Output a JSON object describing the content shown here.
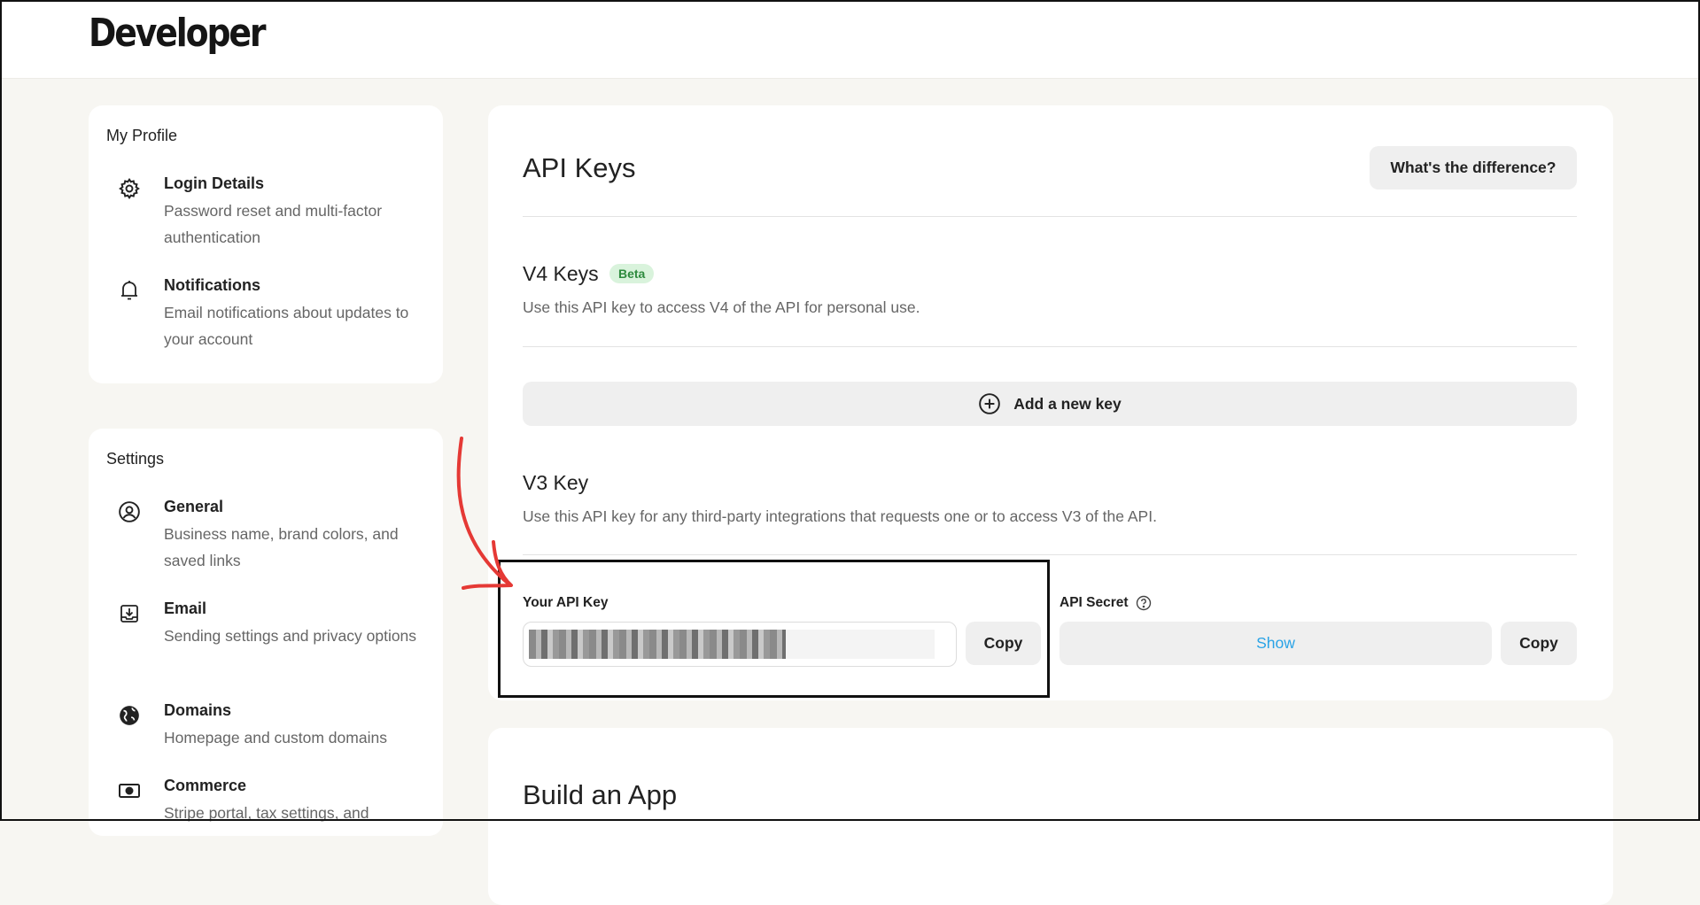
{
  "header": {
    "logo": "Developer"
  },
  "sidebar": {
    "profile": {
      "title": "My Profile",
      "items": [
        {
          "label": "Login Details",
          "desc": "Password reset and multi-factor authentication",
          "icon": "gear-icon"
        },
        {
          "label": "Notifications",
          "desc": "Email notifications about updates to your account",
          "icon": "bell-icon"
        }
      ]
    },
    "settings": {
      "title": "Settings",
      "items": [
        {
          "label": "General",
          "desc": "Business name, brand colors, and saved links",
          "icon": "user-circle-icon"
        },
        {
          "label": "Email",
          "desc": "Sending settings and privacy options",
          "icon": "inbox-download-icon"
        },
        {
          "label": "Domains",
          "desc": "Homepage and custom domains",
          "icon": "globe-icon"
        },
        {
          "label": "Commerce",
          "desc": "Stripe portal, tax settings, and",
          "icon": "money-icon"
        }
      ]
    }
  },
  "main": {
    "title": "API Keys",
    "difference_button": "What's the difference?",
    "v4": {
      "title": "V4 Keys",
      "badge": "Beta",
      "desc": "Use this API key to access V4 of the API for personal use.",
      "add_button": "Add a new key"
    },
    "v3": {
      "title": "V3 Key",
      "desc": "Use this API key for any third-party integrations that requests one or to access V3 of the API.",
      "api_key_label": "Your API Key",
      "copy_label": "Copy",
      "api_secret_label": "API Secret",
      "show_label": "Show",
      "secret_copy_label": "Copy"
    },
    "build_app_title": "Build an App"
  },
  "colors": {
    "page_bg": "#f7f6f2",
    "badge_bg": "#d9f3dc",
    "badge_text": "#2e8b3e",
    "show_link": "#2aa3e6",
    "annotation_arrow": "#e53935"
  }
}
